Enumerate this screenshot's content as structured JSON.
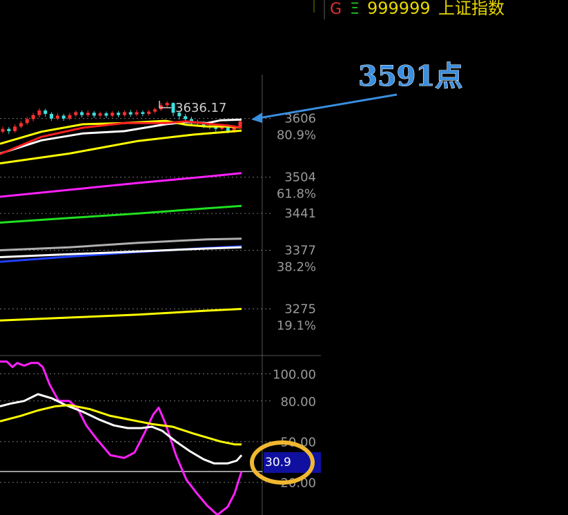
{
  "header": {
    "g_label": "G",
    "eq_label": "Ξ",
    "code": "999999",
    "name": "上证指数"
  },
  "annotation": {
    "text": "3591点",
    "color": "#3a8fe0"
  },
  "chart_data": [
    {
      "type": "line",
      "panel": "price",
      "peak_label": "3636.17",
      "price_levels": [
        {
          "value": 3606,
          "label": "3606",
          "fib": "80.9%"
        },
        {
          "value": 3504,
          "label": "3504",
          "fib": "61.8%"
        },
        {
          "value": 3441,
          "label": "3441",
          "fib": ""
        },
        {
          "value": 3377,
          "label": "3377",
          "fib": "38.2%"
        },
        {
          "value": 3275,
          "label": "3275",
          "fib": "19.1%"
        }
      ],
      "ylim": [
        3200,
        3680
      ],
      "candles": [
        {
          "o": 3583,
          "c": 3588,
          "h": 3592,
          "l": 3580
        },
        {
          "o": 3588,
          "c": 3584,
          "h": 3591,
          "l": 3579
        },
        {
          "o": 3584,
          "c": 3592,
          "h": 3596,
          "l": 3581
        },
        {
          "o": 3592,
          "c": 3598,
          "h": 3602,
          "l": 3589
        },
        {
          "o": 3598,
          "c": 3605,
          "h": 3609,
          "l": 3595
        },
        {
          "o": 3605,
          "c": 3612,
          "h": 3616,
          "l": 3601
        },
        {
          "o": 3612,
          "c": 3620,
          "h": 3624,
          "l": 3608
        },
        {
          "o": 3620,
          "c": 3614,
          "h": 3623,
          "l": 3609
        },
        {
          "o": 3614,
          "c": 3606,
          "h": 3617,
          "l": 3602
        },
        {
          "o": 3606,
          "c": 3611,
          "h": 3615,
          "l": 3603
        },
        {
          "o": 3611,
          "c": 3606,
          "h": 3614,
          "l": 3602
        },
        {
          "o": 3606,
          "c": 3612,
          "h": 3616,
          "l": 3603
        },
        {
          "o": 3612,
          "c": 3617,
          "h": 3620,
          "l": 3609
        },
        {
          "o": 3617,
          "c": 3612,
          "h": 3620,
          "l": 3608
        },
        {
          "o": 3612,
          "c": 3616,
          "h": 3620,
          "l": 3609
        },
        {
          "o": 3616,
          "c": 3611,
          "h": 3619,
          "l": 3607
        },
        {
          "o": 3611,
          "c": 3615,
          "h": 3618,
          "l": 3608
        },
        {
          "o": 3615,
          "c": 3611,
          "h": 3618,
          "l": 3607
        },
        {
          "o": 3611,
          "c": 3616,
          "h": 3619,
          "l": 3608
        },
        {
          "o": 3616,
          "c": 3612,
          "h": 3619,
          "l": 3608
        },
        {
          "o": 3612,
          "c": 3617,
          "h": 3620,
          "l": 3609
        },
        {
          "o": 3617,
          "c": 3613,
          "h": 3621,
          "l": 3609
        },
        {
          "o": 3613,
          "c": 3617,
          "h": 3621,
          "l": 3610
        },
        {
          "o": 3617,
          "c": 3614,
          "h": 3620,
          "l": 3610
        },
        {
          "o": 3614,
          "c": 3618,
          "h": 3621,
          "l": 3611
        },
        {
          "o": 3618,
          "c": 3622,
          "h": 3625,
          "l": 3615
        },
        {
          "o": 3622,
          "c": 3629,
          "h": 3633,
          "l": 3619
        },
        {
          "o": 3629,
          "c": 3633,
          "h": 3636,
          "l": 3626
        },
        {
          "o": 3633,
          "c": 3616,
          "h": 3634,
          "l": 3610
        },
        {
          "o": 3616,
          "c": 3610,
          "h": 3619,
          "l": 3604
        },
        {
          "o": 3610,
          "c": 3605,
          "h": 3614,
          "l": 3600
        },
        {
          "o": 3605,
          "c": 3600,
          "h": 3609,
          "l": 3596
        },
        {
          "o": 3600,
          "c": 3597,
          "h": 3604,
          "l": 3592
        },
        {
          "o": 3597,
          "c": 3593,
          "h": 3601,
          "l": 3589
        },
        {
          "o": 3593,
          "c": 3591,
          "h": 3597,
          "l": 3587
        },
        {
          "o": 3591,
          "c": 3588,
          "h": 3595,
          "l": 3583
        },
        {
          "o": 3588,
          "c": 3592,
          "h": 3596,
          "l": 3585
        },
        {
          "o": 3592,
          "c": 3584,
          "h": 3595,
          "l": 3580
        },
        {
          "o": 3584,
          "c": 3590,
          "h": 3594,
          "l": 3581
        },
        {
          "o": 3590,
          "c": 3601,
          "h": 3604,
          "l": 3588
        }
      ],
      "series": [
        {
          "color": "#ffffff",
          "values": [
            [
              0,
              3545
            ],
            [
              60,
              3568
            ],
            [
              120,
              3580
            ],
            [
              180,
              3584
            ],
            [
              240,
              3596
            ],
            [
              270,
              3600
            ],
            [
              300,
              3598
            ],
            [
              320,
              3603
            ],
            [
              350,
              3604
            ]
          ]
        },
        {
          "color": "#ffff00",
          "values": [
            [
              0,
              3562
            ],
            [
              60,
              3583
            ],
            [
              120,
              3596
            ],
            [
              180,
              3598
            ],
            [
              240,
              3602
            ],
            [
              270,
              3595
            ],
            [
              300,
              3592
            ],
            [
              330,
              3592
            ],
            [
              350,
              3590
            ]
          ]
        },
        {
          "color": "#ff2020",
          "values": [
            [
              0,
              3544
            ],
            [
              60,
              3574
            ],
            [
              120,
              3590
            ],
            [
              180,
              3598
            ],
            [
              240,
              3598
            ],
            [
              270,
              3601
            ],
            [
              300,
              3597
            ],
            [
              330,
              3594
            ],
            [
              350,
              3590
            ]
          ]
        },
        {
          "color": "#ffff00",
          "values": [
            [
              0,
              3528
            ],
            [
              100,
              3545
            ],
            [
              200,
              3567
            ],
            [
              280,
              3578
            ],
            [
              350,
              3585
            ]
          ]
        },
        {
          "color": "#ff20ff",
          "values": [
            [
              0,
              3470
            ],
            [
              100,
              3482
            ],
            [
              200,
              3494
            ],
            [
              300,
              3505
            ],
            [
              350,
              3511
            ]
          ]
        },
        {
          "color": "#20e020",
          "values": [
            [
              0,
              3425
            ],
            [
              100,
              3433
            ],
            [
              200,
              3441
            ],
            [
              300,
              3450
            ],
            [
              350,
              3454
            ]
          ]
        },
        {
          "color": "#b0b0b0",
          "values": [
            [
              0,
              3377
            ],
            [
              100,
              3382
            ],
            [
              200,
              3390
            ],
            [
              300,
              3396
            ],
            [
              350,
              3397
            ]
          ]
        },
        {
          "color": "#2040ff",
          "values": [
            [
              0,
              3357
            ],
            [
              100,
              3366
            ],
            [
              200,
              3374
            ],
            [
              300,
              3381
            ],
            [
              350,
              3384
            ]
          ]
        },
        {
          "color": "#ffffff",
          "values": [
            [
              0,
              3365
            ],
            [
              100,
              3370
            ],
            [
              200,
              3375
            ],
            [
              300,
              3380
            ],
            [
              350,
              3382
            ]
          ]
        },
        {
          "color": "#ffff00",
          "values": [
            [
              0,
              3255
            ],
            [
              100,
              3260
            ],
            [
              200,
              3265
            ],
            [
              300,
              3272
            ],
            [
              350,
              3275
            ]
          ]
        }
      ]
    },
    {
      "type": "line",
      "panel": "oscillator",
      "y_ticks": [
        "100.00",
        "80.00",
        "50.00",
        "20.00"
      ],
      "ylim": [
        0,
        115
      ],
      "current_value": "30.9",
      "series": [
        {
          "color": "#ff20ff",
          "values": [
            [
              0,
              109
            ],
            [
              10,
              109
            ],
            [
              18,
              105
            ],
            [
              25,
              108
            ],
            [
              35,
              106
            ],
            [
              45,
              108
            ],
            [
              55,
              108
            ],
            [
              62,
              105
            ],
            [
              72,
              92
            ],
            [
              85,
              80
            ],
            [
              100,
              80
            ],
            [
              112,
              75
            ],
            [
              125,
              62
            ],
            [
              140,
              52
            ],
            [
              160,
              40
            ],
            [
              180,
              38
            ],
            [
              195,
              42
            ],
            [
              210,
              57
            ],
            [
              222,
              70
            ],
            [
              230,
              75
            ],
            [
              240,
              63
            ],
            [
              255,
              40
            ],
            [
              270,
              22
            ],
            [
              285,
              12
            ],
            [
              300,
              3
            ],
            [
              315,
              -4
            ],
            [
              330,
              2
            ],
            [
              340,
              12
            ],
            [
              350,
              28
            ]
          ]
        },
        {
          "color": "#ffffff",
          "values": [
            [
              0,
              76
            ],
            [
              15,
              78
            ],
            [
              35,
              80
            ],
            [
              55,
              85
            ],
            [
              75,
              82
            ],
            [
              95,
              77
            ],
            [
              120,
              72
            ],
            [
              145,
              66
            ],
            [
              165,
              62
            ],
            [
              185,
              60
            ],
            [
              205,
              60
            ],
            [
              220,
              61
            ],
            [
              235,
              58
            ],
            [
              255,
              50
            ],
            [
              275,
              43
            ],
            [
              295,
              37
            ],
            [
              310,
              34
            ],
            [
              330,
              34
            ],
            [
              343,
              36
            ],
            [
              350,
              40
            ]
          ]
        },
        {
          "color": "#ffff00",
          "values": [
            [
              0,
              65
            ],
            [
              30,
              69
            ],
            [
              55,
              73
            ],
            [
              80,
              76
            ],
            [
              100,
              77
            ],
            [
              130,
              74
            ],
            [
              160,
              69
            ],
            [
              190,
              66
            ],
            [
              220,
              63
            ],
            [
              250,
              61
            ],
            [
              280,
              56
            ],
            [
              300,
              53
            ],
            [
              320,
              50
            ],
            [
              340,
              48
            ],
            [
              350,
              48
            ]
          ]
        }
      ]
    }
  ]
}
